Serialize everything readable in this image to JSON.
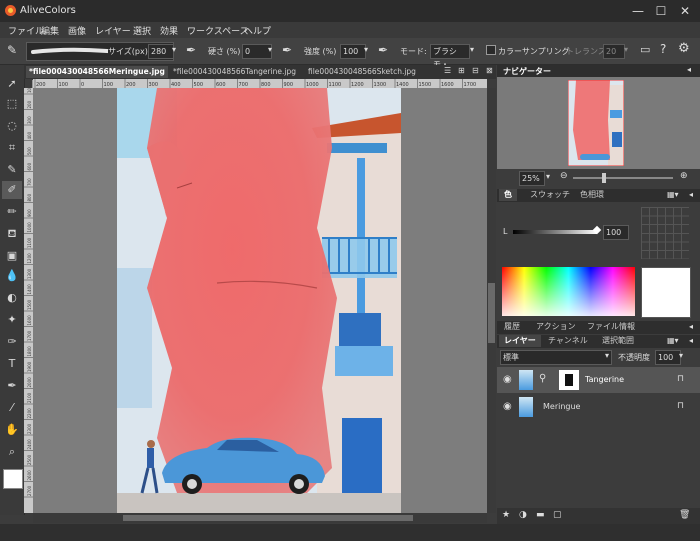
{
  "app": {
    "title": "AliveColors"
  },
  "window": {
    "minimize": "—",
    "maximize": "☐",
    "close": "✕"
  },
  "menu": [
    "ファイル",
    "編集",
    "画像",
    "レイヤー",
    "選択",
    "効果",
    "ワークスペース",
    "ヘルプ"
  ],
  "options": {
    "size_label": "サイズ(px)",
    "size_value": "280",
    "hardness_label": "硬さ (%)",
    "hardness_value": "0",
    "strength_label": "強度 (%)",
    "strength_value": "100",
    "mode_label": "モード:",
    "mode_value": "ブラシモ・",
    "color_sampling_label": "カラーサンプリング",
    "tolerance_label": "トレランス",
    "tolerance_value": "20"
  },
  "tabs": [
    {
      "label": "*file000430048566Meringue.jpg",
      "active": true
    },
    {
      "label": "*file000430048566Tangerine.jpg",
      "active": false
    },
    {
      "label": "file000430048566Sketch.jpg",
      "active": false
    }
  ],
  "ruler_h": [
    "200",
    "100",
    "0",
    "100",
    "200",
    "300",
    "400",
    "500",
    "600",
    "700",
    "800",
    "900",
    "1000",
    "1100",
    "1200",
    "1300",
    "1400",
    "1500",
    "1600",
    "1700"
  ],
  "ruler_v": [
    "100",
    "200",
    "300",
    "400",
    "500",
    "600",
    "700",
    "800",
    "900",
    "1000",
    "1100",
    "1200",
    "1300",
    "1400",
    "1500",
    "1600",
    "1700",
    "1800",
    "1900",
    "2000",
    "2100",
    "2200",
    "2300",
    "2400",
    "2500",
    "2600",
    "2700"
  ],
  "navigator": {
    "title": "ナビゲーター",
    "zoom": "25%"
  },
  "color_panel": {
    "tabs": [
      "色",
      "スウォッチ",
      "色相環"
    ],
    "l_label": "L",
    "l_value": "100"
  },
  "history_tabs": [
    "履歴",
    "アクション",
    "ファイル情報"
  ],
  "layers_panel": {
    "tabs": [
      "レイヤー",
      "チャンネル",
      "選択範囲"
    ],
    "blend_mode": "標準",
    "opacity_label": "不透明度",
    "opacity_value": "100",
    "layers": [
      {
        "name": "Tangerine",
        "selected": true
      },
      {
        "name": "Meringue",
        "selected": false
      }
    ]
  },
  "colors": {
    "fg": "#ffffff",
    "accent": "#3a7bd5"
  }
}
